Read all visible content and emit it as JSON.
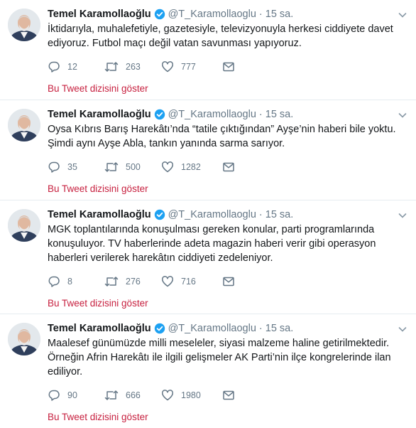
{
  "tweets": [
    {
      "name": "Temel Karamollaoğlu",
      "handle": "@T_Karamollaoglu",
      "dot": "·",
      "time": "15 sa.",
      "text": "İktidarıyla, muhalefetiyle, gazetesiyle, televizyonuyla herkesi ciddiyete davet ediyoruz. Futbol maçı değil vatan savunması yapıyoruz.",
      "replies": "12",
      "retweets": "263",
      "likes": "777",
      "thread_label": "Bu Tweet dizisini göster"
    },
    {
      "name": "Temel Karamollaoğlu",
      "handle": "@T_Karamollaoglu",
      "dot": "·",
      "time": "15 sa.",
      "text": "Oysa Kıbrıs Barış Harekâtı’nda “tatile çıktığından” Ayşe’nin haberi bile yoktu. Şimdi aynı Ayşe Abla, tankın yanında sarma sarıyor.",
      "replies": "35",
      "retweets": "500",
      "likes": "1282",
      "thread_label": "Bu Tweet dizisini göster"
    },
    {
      "name": "Temel Karamollaoğlu",
      "handle": "@T_Karamollaoglu",
      "dot": "·",
      "time": "15 sa.",
      "text": "MGK toplantılarında konuşulması gereken konular, parti programlarında konuşuluyor. TV haberlerinde adeta magazin haberi verir gibi operasyon haberleri verilerek harekâtın ciddiyeti zedeleniyor.",
      "replies": "8",
      "retweets": "276",
      "likes": "716",
      "thread_label": "Bu Tweet dizisini göster"
    },
    {
      "name": "Temel Karamollaoğlu",
      "handle": "@T_Karamollaoglu",
      "dot": "·",
      "time": "15 sa.",
      "text": "Maalesef günümüzde milli meseleler, siyasi malzeme haline getirilmektedir. Örneğin Afrin Harekâtı ile ilgili gelişmeler AK Parti’nin ilçe kongrelerinde ilan ediliyor.",
      "replies": "90",
      "retweets": "666",
      "likes": "1980",
      "thread_label": "Bu Tweet dizisini göster"
    }
  ],
  "colors": {
    "accent": "#c7203f",
    "muted": "#657786",
    "verified": "#1da1f2",
    "divider": "#e6ecf0"
  },
  "icons": {
    "reply": "reply-icon",
    "retweet": "retweet-icon",
    "like": "heart-icon",
    "dm": "envelope-icon",
    "verified": "verified-badge-icon",
    "caret": "chevron-down-icon"
  }
}
